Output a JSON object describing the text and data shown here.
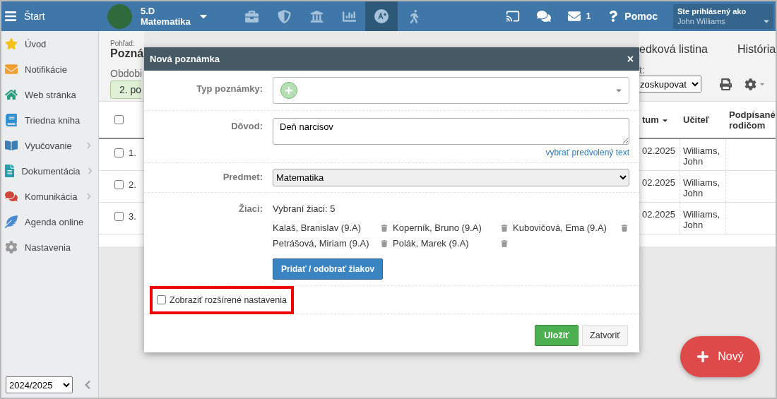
{
  "topbar": {
    "menu_label": "Štart",
    "class_name": "5.D",
    "subject": "Matematika",
    "tools": [
      {
        "selected": false
      },
      {
        "selected": false
      },
      {
        "selected": false
      },
      {
        "selected": false
      },
      {
        "selected": true
      },
      {
        "selected": false
      }
    ],
    "mail_count": "1",
    "help": "Pomoc",
    "user_caption": "Ste prihlásený ako",
    "user_name": "John Williams"
  },
  "sidebar": {
    "items": [
      {
        "label": "Úvod",
        "expandable": false
      },
      {
        "label": "Notifikácie",
        "expandable": false
      },
      {
        "label": "Web stránka",
        "expandable": false
      },
      {
        "label": "Triedna kniha",
        "expandable": false
      },
      {
        "label": "Vyučovanie",
        "expandable": true
      },
      {
        "label": "Dokumentácia",
        "expandable": true
      },
      {
        "label": "Komunikácia",
        "expandable": true
      },
      {
        "label": "Agenda online",
        "expandable": false
      },
      {
        "label": "Nastavenia",
        "expandable": false
      }
    ],
    "year": "2024/2025"
  },
  "page": {
    "view_label": "Pohľad:",
    "view_title": "Pozná",
    "period_label": "Obdobi",
    "period_button": "2. po",
    "tabs": [
      "edková listina",
      "História"
    ],
    "group_label": "t:",
    "group_select": "zoskupovat",
    "header_checked": false,
    "columns": [
      {
        "label": "tum",
        "sorted": true
      },
      {
        "label": "Učiteľ",
        "sorted": false
      },
      {
        "label": "Podpísané rodičom",
        "sorted": false
      }
    ],
    "rows": [
      {
        "number": "1.",
        "checked": false,
        "date": "02.2025",
        "teacher": "Williams, John"
      },
      {
        "number": "2.",
        "checked": false,
        "date": "02.2025",
        "teacher": "Williams, John"
      },
      {
        "number": "3.",
        "checked": false,
        "date": "02.2025",
        "teacher": "Williams, John"
      }
    ],
    "new_button": "Nový"
  },
  "dialog": {
    "title": "Nová poznámka",
    "close": "×",
    "type_label": "Typ poznámky:",
    "reason_label": "Dôvod:",
    "reason_value": "Deň narcisov",
    "reason_link": "vybrať predvolený text",
    "subject_label": "Predmet:",
    "subject_value": "Matematika",
    "students_label": "Žiaci:",
    "students_summary": "Vybraní žiaci: 5",
    "students": [
      {
        "name": "Kalaš, Branislav (9.A)"
      },
      {
        "name": "Koperník, Bruno (9.A)"
      },
      {
        "name": "Kubovičová, Ema (9.A)"
      },
      {
        "name": "Petrášová, Miriam (9.A)"
      },
      {
        "name": "Polák, Marek (9.A)"
      }
    ],
    "students_button": "Pridať / odobrať žiakov",
    "advanced": {
      "label": "Zobraziť rozšírené nastavenia",
      "checked": false,
      "highlighted": true
    },
    "save": "Uložiť",
    "cancel": "Zatvoriť"
  }
}
